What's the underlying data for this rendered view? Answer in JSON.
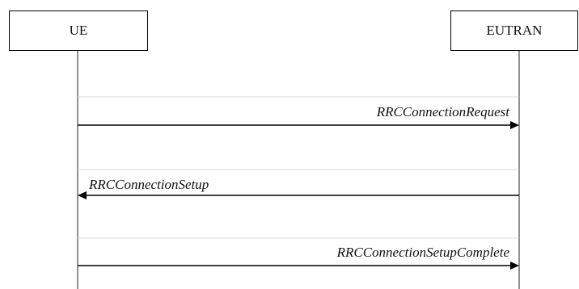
{
  "entities": {
    "left": "UE",
    "right": "EUTRAN"
  },
  "messages": [
    {
      "label": "RRCConnectionRequest",
      "direction": "UE → EUTRAN"
    },
    {
      "label": "RRCConnectionSetup",
      "direction": "EUTRAN → UE"
    },
    {
      "label": "RRCConnectionSetupComplete",
      "direction": "UE → EUTRAN"
    }
  ],
  "colors": {
    "line": "#000000",
    "step_separator": "#d9d9d9"
  }
}
